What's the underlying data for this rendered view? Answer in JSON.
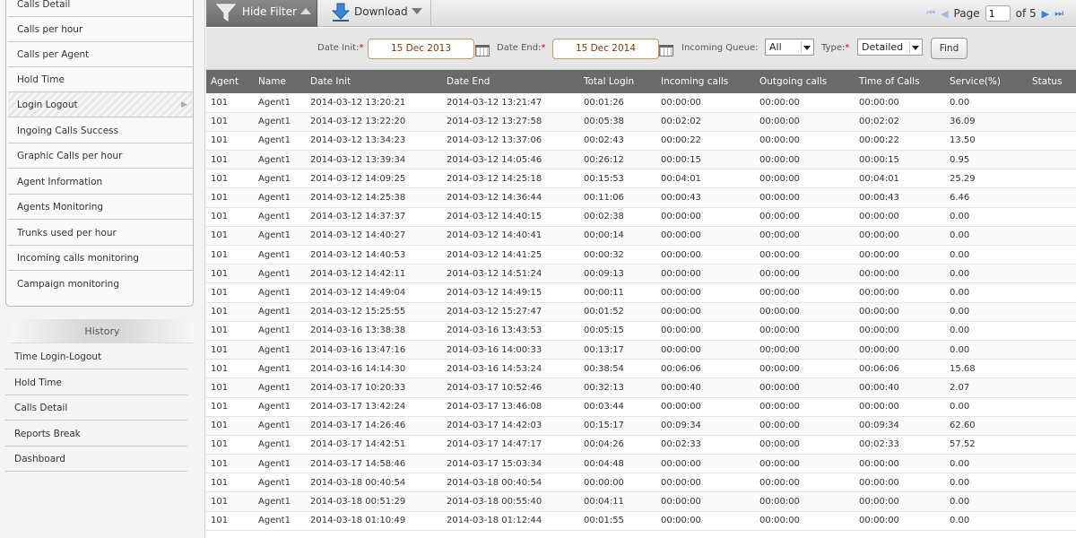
{
  "sidebar": {
    "menu": [
      {
        "label": "Calls Detail"
      },
      {
        "label": "Calls per hour"
      },
      {
        "label": "Calls per Agent"
      },
      {
        "label": "Hold Time"
      },
      {
        "label": "Login Logout"
      },
      {
        "label": "Ingoing Calls Success"
      },
      {
        "label": "Graphic Calls per hour"
      },
      {
        "label": "Agent Information"
      },
      {
        "label": "Agents Monitoring"
      },
      {
        "label": "Trunks used per hour"
      },
      {
        "label": "Incoming calls monitoring"
      },
      {
        "label": "Campaign monitoring"
      }
    ],
    "history_title": "History",
    "history": [
      {
        "label": "Time Login-Logout"
      },
      {
        "label": "Hold Time"
      },
      {
        "label": "Calls Detail"
      },
      {
        "label": "Reports Break"
      },
      {
        "label": "Dashboard"
      }
    ]
  },
  "toolbar": {
    "hide_filter_label": "Hide Filter",
    "download_label": "Download",
    "page_label": "Page",
    "page_value": "1",
    "page_of": "of 5"
  },
  "filter": {
    "date_init_label": "Date Init:",
    "date_init_value": "15 Dec 2013",
    "date_end_label": "Date End:",
    "date_end_value": "15 Dec 2014",
    "queue_label": "Incoming Queue:",
    "queue_value": "All",
    "type_label": "Type:",
    "type_value": "Detailed",
    "required_mark": "*",
    "find_label": "Find"
  },
  "table": {
    "columns": [
      "Agent",
      "Name",
      "Date Init",
      "Date End",
      "Total Login",
      "Incoming calls",
      "Outgoing calls",
      "Time of Calls",
      "Service(%)",
      "Status"
    ],
    "rows": [
      [
        "101",
        "Agent1",
        "2014-03-12 13:20:21",
        "2014-03-12 13:21:47",
        "00:01:26",
        "00:00:00",
        "00:00:00",
        "00:00:00",
        "0.00",
        ""
      ],
      [
        "101",
        "Agent1",
        "2014-03-12 13:22:20",
        "2014-03-12 13:27:58",
        "00:05:38",
        "00:02:02",
        "00:00:00",
        "00:02:02",
        "36.09",
        ""
      ],
      [
        "101",
        "Agent1",
        "2014-03-12 13:34:23",
        "2014-03-12 13:37:06",
        "00:02:43",
        "00:00:22",
        "00:00:00",
        "00:00:22",
        "13.50",
        ""
      ],
      [
        "101",
        "Agent1",
        "2014-03-12 13:39:34",
        "2014-03-12 14:05:46",
        "00:26:12",
        "00:00:15",
        "00:00:00",
        "00:00:15",
        "0.95",
        ""
      ],
      [
        "101",
        "Agent1",
        "2014-03-12 14:09:25",
        "2014-03-12 14:25:18",
        "00:15:53",
        "00:04:01",
        "00:00:00",
        "00:04:01",
        "25.29",
        ""
      ],
      [
        "101",
        "Agent1",
        "2014-03-12 14:25:38",
        "2014-03-12 14:36:44",
        "00:11:06",
        "00:00:43",
        "00:00:00",
        "00:00:43",
        "6.46",
        ""
      ],
      [
        "101",
        "Agent1",
        "2014-03-12 14:37:37",
        "2014-03-12 14:40:15",
        "00:02:38",
        "00:00:00",
        "00:00:00",
        "00:00:00",
        "0.00",
        ""
      ],
      [
        "101",
        "Agent1",
        "2014-03-12 14:40:27",
        "2014-03-12 14:40:41",
        "00:00:14",
        "00:00:00",
        "00:00:00",
        "00:00:00",
        "0.00",
        ""
      ],
      [
        "101",
        "Agent1",
        "2014-03-12 14:40:53",
        "2014-03-12 14:41:25",
        "00:00:32",
        "00:00:00",
        "00:00:00",
        "00:00:00",
        "0.00",
        ""
      ],
      [
        "101",
        "Agent1",
        "2014-03-12 14:42:11",
        "2014-03-12 14:51:24",
        "00:09:13",
        "00:00:00",
        "00:00:00",
        "00:00:00",
        "0.00",
        ""
      ],
      [
        "101",
        "Agent1",
        "2014-03-12 14:49:04",
        "2014-03-12 14:49:15",
        "00:00:11",
        "00:00:00",
        "00:00:00",
        "00:00:00",
        "0.00",
        ""
      ],
      [
        "101",
        "Agent1",
        "2014-03-12 15:25:55",
        "2014-03-12 15:27:47",
        "00:01:52",
        "00:00:00",
        "00:00:00",
        "00:00:00",
        "0.00",
        ""
      ],
      [
        "101",
        "Agent1",
        "2014-03-16 13:38:38",
        "2014-03-16 13:43:53",
        "00:05:15",
        "00:00:00",
        "00:00:00",
        "00:00:00",
        "0.00",
        ""
      ],
      [
        "101",
        "Agent1",
        "2014-03-16 13:47:16",
        "2014-03-16 14:00:33",
        "00:13:17",
        "00:00:00",
        "00:00:00",
        "00:00:00",
        "0.00",
        ""
      ],
      [
        "101",
        "Agent1",
        "2014-03-16 14:14:30",
        "2014-03-16 14:53:24",
        "00:38:54",
        "00:06:06",
        "00:00:00",
        "00:06:06",
        "15.68",
        ""
      ],
      [
        "101",
        "Agent1",
        "2014-03-17 10:20:33",
        "2014-03-17 10:52:46",
        "00:32:13",
        "00:00:40",
        "00:00:00",
        "00:00:40",
        "2.07",
        ""
      ],
      [
        "101",
        "Agent1",
        "2014-03-17 13:42:24",
        "2014-03-17 13:46:08",
        "00:03:44",
        "00:00:00",
        "00:00:00",
        "00:00:00",
        "0.00",
        ""
      ],
      [
        "101",
        "Agent1",
        "2014-03-17 14:26:46",
        "2014-03-17 14:42:03",
        "00:15:17",
        "00:09:34",
        "00:00:00",
        "00:09:34",
        "62.60",
        ""
      ],
      [
        "101",
        "Agent1",
        "2014-03-17 14:42:51",
        "2014-03-17 14:47:17",
        "00:04:26",
        "00:02:33",
        "00:00:00",
        "00:02:33",
        "57.52",
        ""
      ],
      [
        "101",
        "Agent1",
        "2014-03-17 14:58:46",
        "2014-03-17 15:03:34",
        "00:04:48",
        "00:00:00",
        "00:00:00",
        "00:00:00",
        "0.00",
        ""
      ],
      [
        "101",
        "Agent1",
        "2014-03-18 00:40:54",
        "2014-03-18 00:40:54",
        "00:00:00",
        "00:00:00",
        "00:00:00",
        "00:00:00",
        "0.00",
        ""
      ],
      [
        "101",
        "Agent1",
        "2014-03-18 00:51:29",
        "2014-03-18 00:55:40",
        "00:04:11",
        "00:00:00",
        "00:00:00",
        "00:00:00",
        "0.00",
        ""
      ],
      [
        "101",
        "Agent1",
        "2014-03-18 01:10:49",
        "2014-03-18 01:12:44",
        "00:01:55",
        "00:00:00",
        "00:00:00",
        "00:00:00",
        "0.00",
        ""
      ]
    ]
  },
  "icons": {
    "hide_filter": "funnel-icon",
    "download": "download-arrow-icon",
    "calendar": "calendar-icon",
    "pager_first": "first-page-icon",
    "pager_prev": "prev-page-icon",
    "pager_next": "next-page-icon",
    "pager_last": "last-page-icon"
  },
  "colors": {
    "table_header_bg": "#6a6a6a",
    "date_border": "#c79a6c",
    "pager_arrow": "#3a7fd8",
    "required": "#dd0000"
  }
}
